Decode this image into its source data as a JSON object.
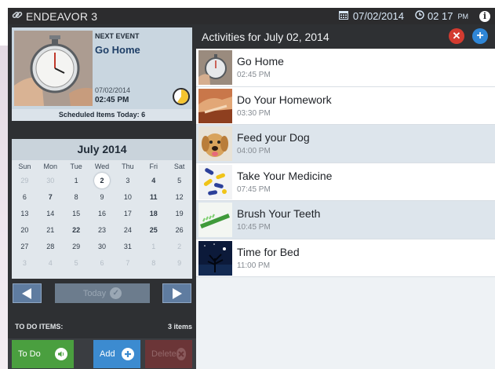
{
  "app": {
    "title": "ENDEAVOR 3"
  },
  "status": {
    "date": "07/02/2014",
    "time": "02 17",
    "ampm": "PM"
  },
  "next_event": {
    "label": "NEXT EVENT",
    "title": "Go Home",
    "date": "07/02/2014",
    "time": "02:45 PM",
    "scheduled_text": "Scheduled Items Today: 6"
  },
  "calendar": {
    "month_title": "July 2014",
    "days_of_week": [
      "Sun",
      "Mon",
      "Tue",
      "Wed",
      "Thu",
      "Fri",
      "Sat"
    ],
    "weeks": [
      [
        {
          "d": "29",
          "m": true
        },
        {
          "d": "30",
          "m": true
        },
        {
          "d": "1"
        },
        {
          "d": "2",
          "t": true
        },
        {
          "d": "3"
        },
        {
          "d": "4",
          "b": true
        },
        {
          "d": "5"
        }
      ],
      [
        {
          "d": "6"
        },
        {
          "d": "7",
          "b": true
        },
        {
          "d": "8"
        },
        {
          "d": "9"
        },
        {
          "d": "10"
        },
        {
          "d": "11",
          "b": true
        },
        {
          "d": "12"
        }
      ],
      [
        {
          "d": "13"
        },
        {
          "d": "14"
        },
        {
          "d": "15"
        },
        {
          "d": "16"
        },
        {
          "d": "17"
        },
        {
          "d": "18",
          "b": true
        },
        {
          "d": "19"
        }
      ],
      [
        {
          "d": "20"
        },
        {
          "d": "21"
        },
        {
          "d": "22",
          "b": true
        },
        {
          "d": "23"
        },
        {
          "d": "24"
        },
        {
          "d": "25",
          "b": true
        },
        {
          "d": "26"
        }
      ],
      [
        {
          "d": "27"
        },
        {
          "d": "28"
        },
        {
          "d": "29"
        },
        {
          "d": "30"
        },
        {
          "d": "31"
        },
        {
          "d": "1",
          "m": true
        },
        {
          "d": "2",
          "m": true
        }
      ],
      [
        {
          "d": "3",
          "m": true
        },
        {
          "d": "4",
          "m": true
        },
        {
          "d": "5",
          "m": true
        },
        {
          "d": "6",
          "m": true
        },
        {
          "d": "7",
          "m": true
        },
        {
          "d": "8",
          "m": true
        },
        {
          "d": "9",
          "m": true
        }
      ]
    ],
    "today_label": "Today"
  },
  "todo": {
    "title": "TO DO ITEMS:",
    "count": "3 items",
    "todo_button": "To Do",
    "add_button": "Add",
    "delete_button": "Delete"
  },
  "activities": {
    "header": "Activities for July 02, 2014",
    "items": [
      {
        "title": "Go Home",
        "time": "02:45 PM",
        "thumb": "stopwatch"
      },
      {
        "title": "Do Your Homework",
        "time": "03:30 PM",
        "thumb": "homework"
      },
      {
        "title": "Feed your Dog",
        "time": "04:00 PM",
        "thumb": "dog"
      },
      {
        "title": "Take Your Medicine",
        "time": "07:45 PM",
        "thumb": "pills"
      },
      {
        "title": "Brush Your Teeth",
        "time": "10:45 PM",
        "thumb": "toothbrush"
      },
      {
        "title": "Time for Bed",
        "time": "11:00 PM",
        "thumb": "night-tree"
      }
    ]
  },
  "colors": {
    "todo_green": "#4a9f3f",
    "add_blue": "#3c8bd0",
    "close_red": "#d33b30",
    "header_dark": "#2e3033"
  }
}
